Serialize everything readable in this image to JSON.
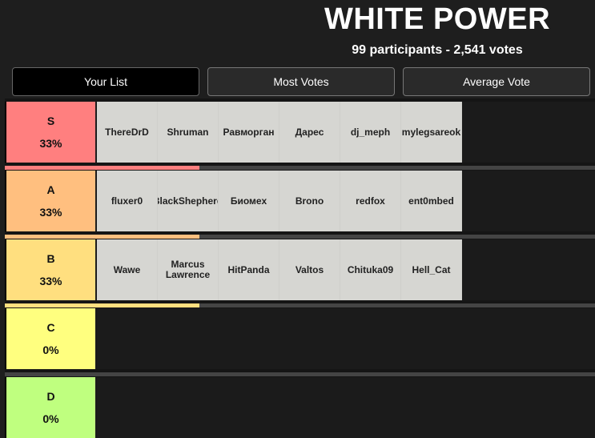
{
  "header": {
    "title": "WHITE POWER",
    "subtitle": "99 participants - 2,541 votes"
  },
  "tabs": [
    {
      "label": "Your List",
      "active": true
    },
    {
      "label": "Most Votes",
      "active": false
    },
    {
      "label": "Average Vote",
      "active": false
    }
  ],
  "tiers": [
    {
      "letter": "S",
      "percent": "33%",
      "color": "#ff7f7f",
      "fill": 0.33,
      "items": [
        "ThereDrD",
        "Shruman",
        "Равморган",
        "Дарес",
        "dj_meph",
        "mylegsareok"
      ]
    },
    {
      "letter": "A",
      "percent": "33%",
      "color": "#ffbf7f",
      "fill": 0.33,
      "items": [
        "fluxer0",
        "BlackShepherd",
        "Биомех",
        "Brono",
        "redfox",
        "ent0mbed"
      ]
    },
    {
      "letter": "B",
      "percent": "33%",
      "color": "#ffdf7f",
      "fill": 0.33,
      "items": [
        "Wawe",
        "Marcus Lawrence",
        "HitPanda",
        "Valtos",
        "Chituka09",
        "Hell_Cat"
      ]
    },
    {
      "letter": "C",
      "percent": "0%",
      "color": "#ffff7f",
      "fill": 0,
      "items": []
    },
    {
      "letter": "D",
      "percent": "0%",
      "color": "#bfff7f",
      "fill": 0,
      "items": []
    }
  ]
}
